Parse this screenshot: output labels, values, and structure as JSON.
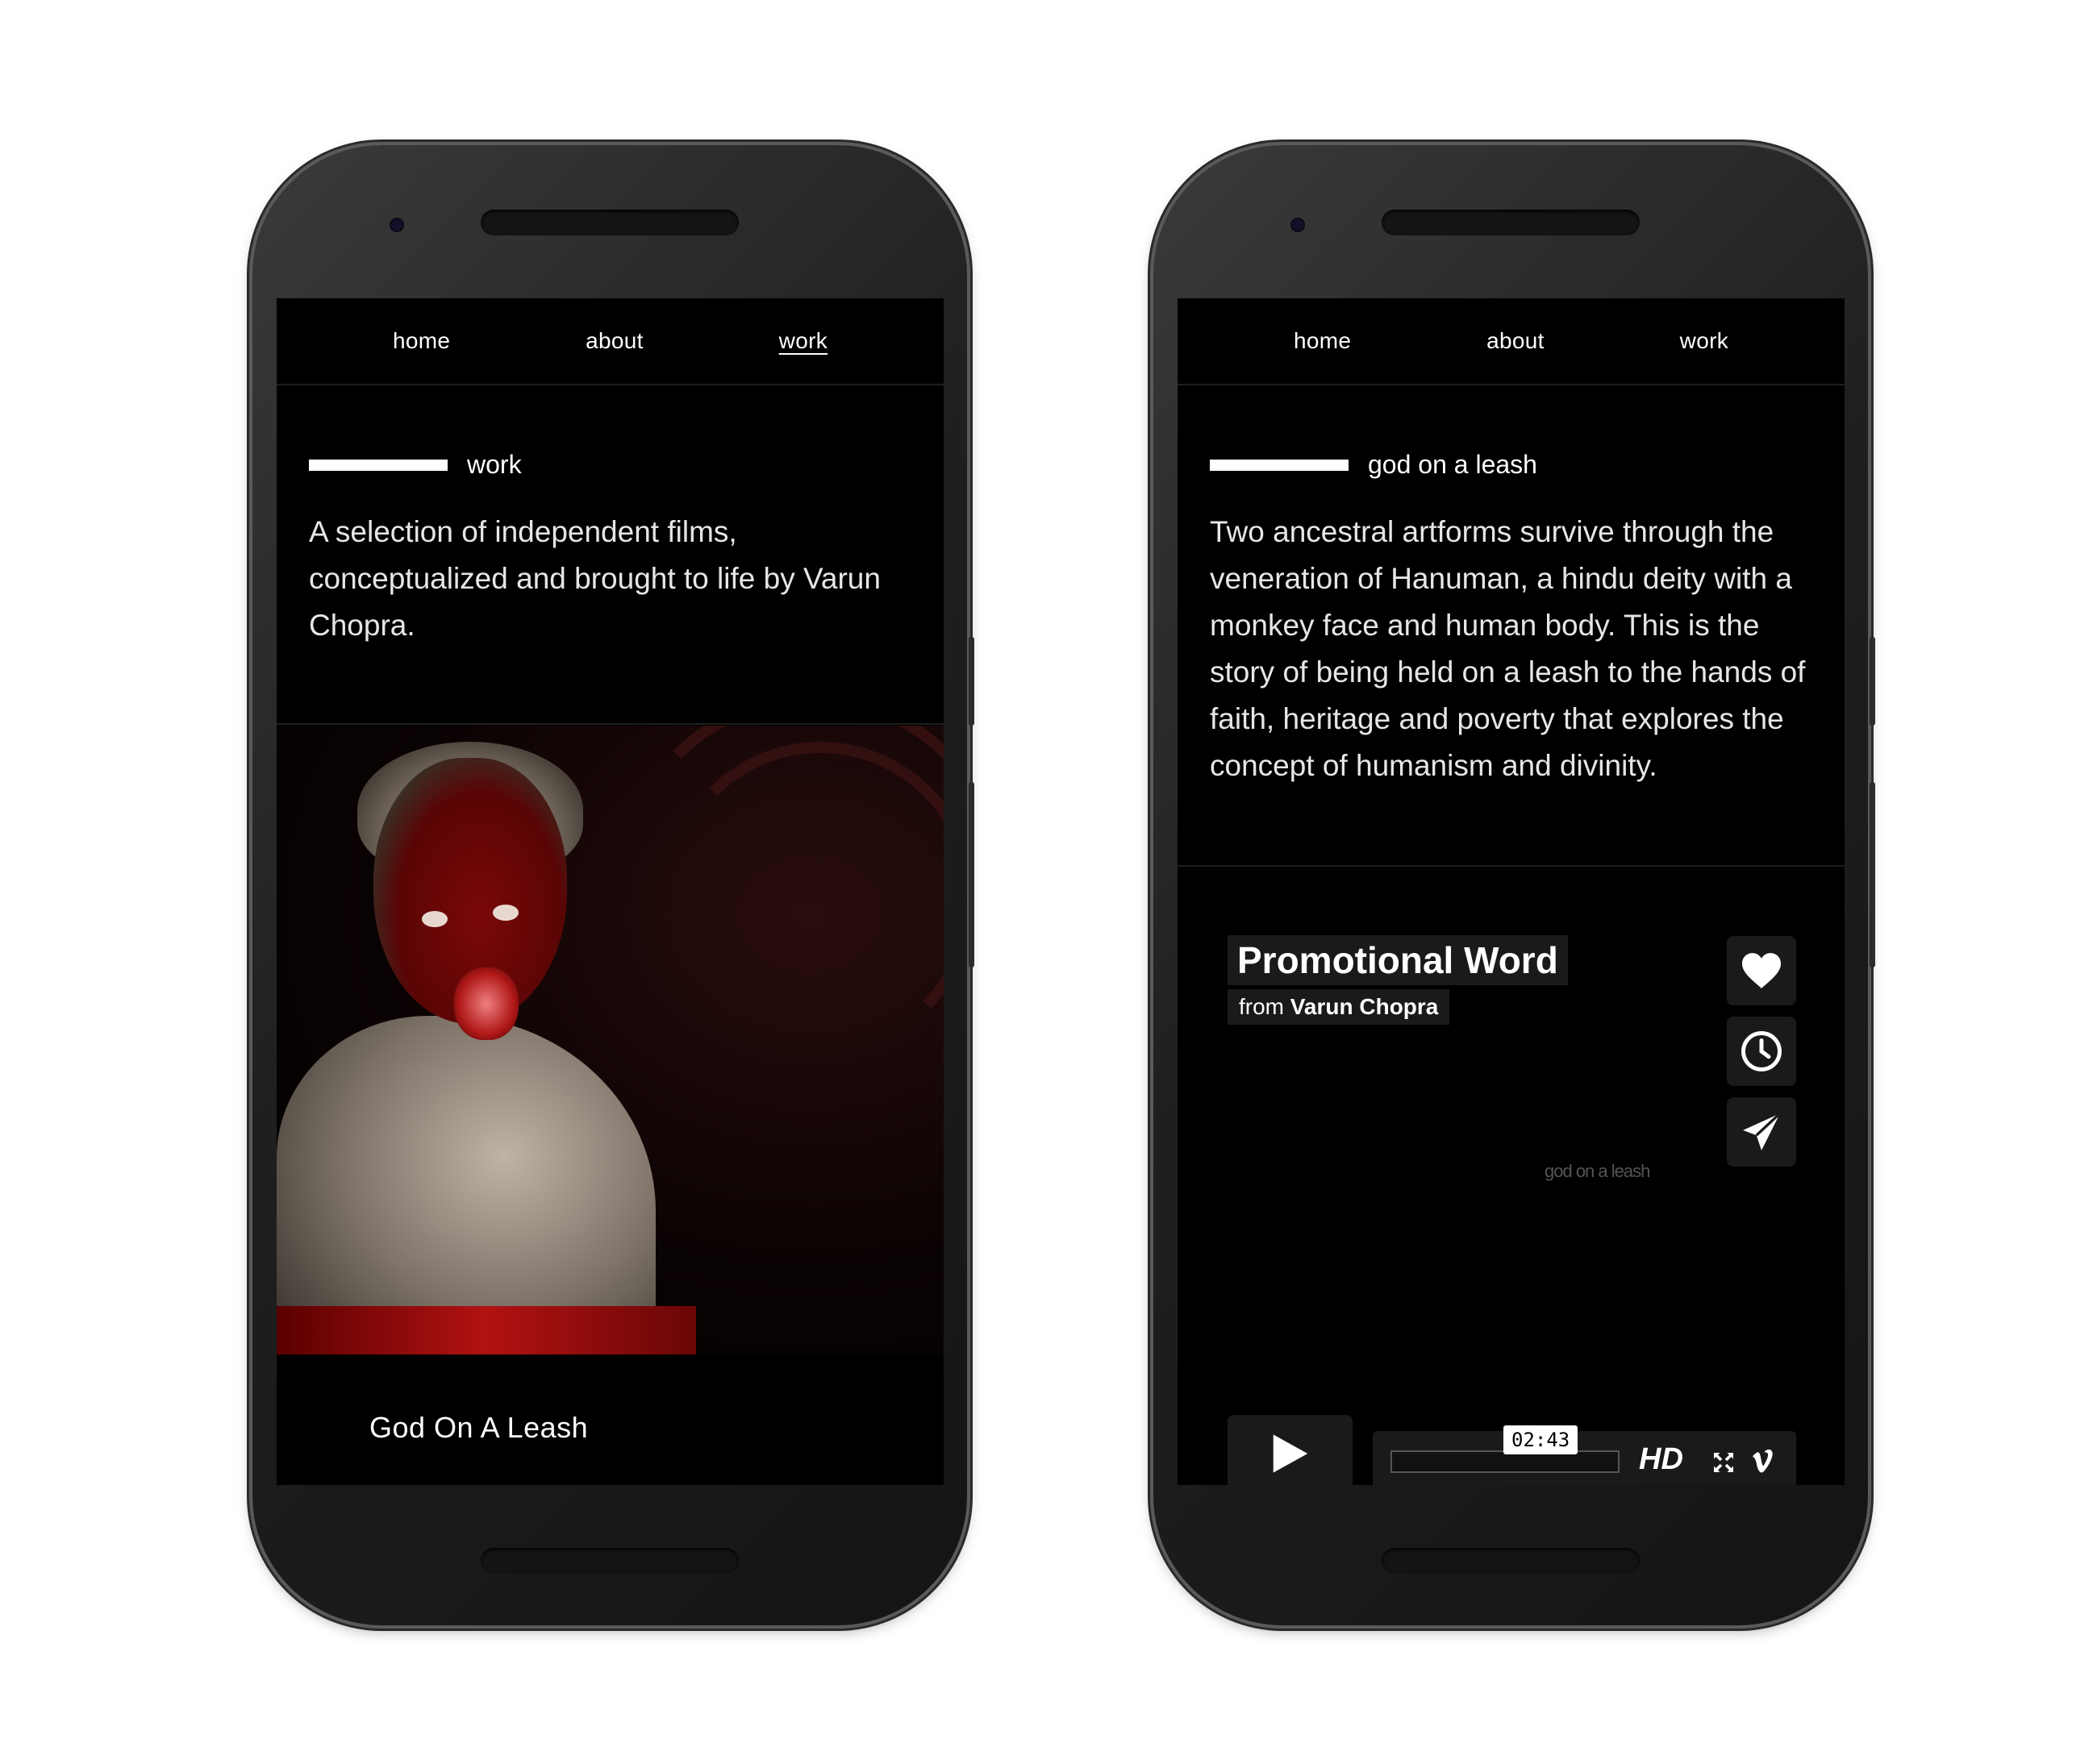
{
  "left_phone": {
    "nav": [
      {
        "label": "home",
        "active": false
      },
      {
        "label": "about",
        "active": false
      },
      {
        "label": "work",
        "active": true
      }
    ],
    "section_heading": "work",
    "description": "A selection of independent films, conceptualized and brought to life by Varun Chopra.",
    "film_title": "God On A Leash"
  },
  "right_phone": {
    "nav": [
      {
        "label": "home",
        "active": false
      },
      {
        "label": "about",
        "active": false
      },
      {
        "label": "work",
        "active": false
      }
    ],
    "section_heading": "god on a leash",
    "description": "Two ancestral artforms survive through the veneration of Hanuman, a hindu deity with a monkey face and human body. This is the story of being held on a leash to the hands of faith, heritage and poverty that explores the concept of humanism and divinity.",
    "video": {
      "title": "Promotional Word",
      "from_prefix": "from",
      "author": "Varun Chopra",
      "watermark": "god on a leash",
      "time": "02:43",
      "hd_label": "HD",
      "side_buttons": [
        "heart-icon",
        "clock-icon",
        "send-icon"
      ]
    }
  },
  "colors": {
    "screen_bg": "#000000",
    "text": "#ffffff",
    "control_bg": "#1a1a1a"
  }
}
